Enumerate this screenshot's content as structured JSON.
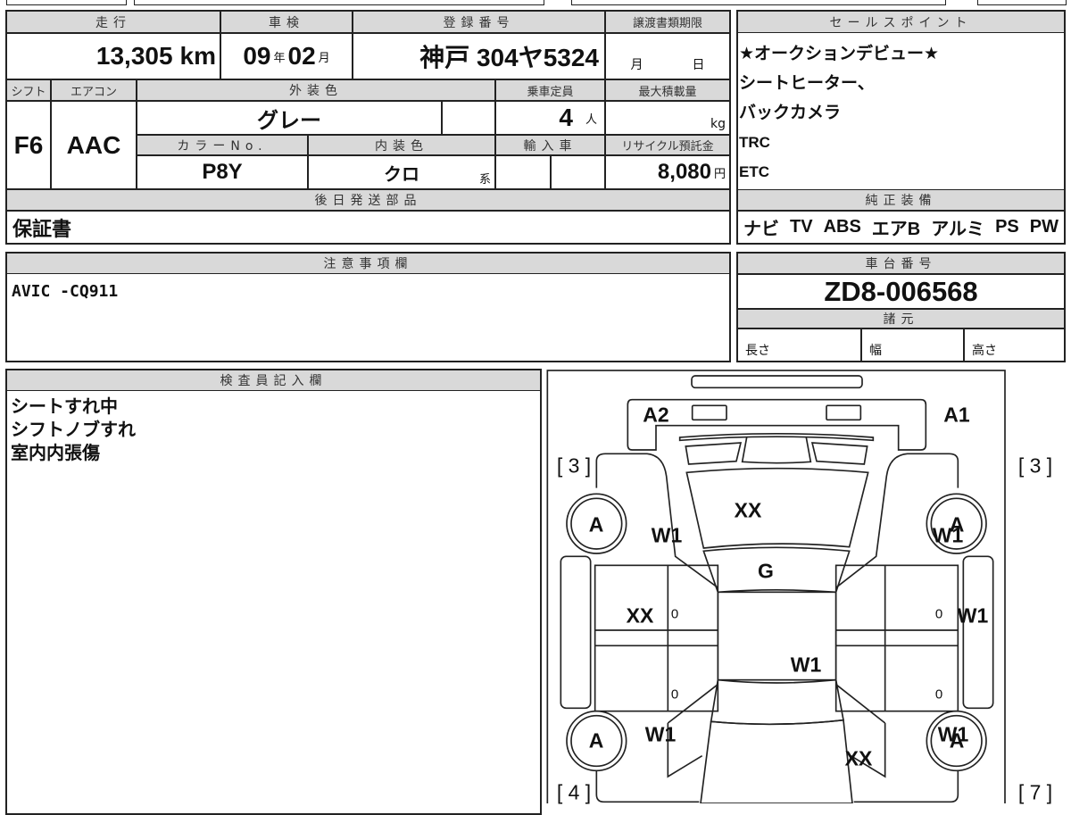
{
  "main_table": {
    "mileage": {
      "header": "走行",
      "value": "13,305",
      "unit": "km"
    },
    "inspection": {
      "header": "車検",
      "year": "09",
      "year_unit": "年",
      "month": "02",
      "month_unit": "月"
    },
    "registration": {
      "header": "登録番号",
      "value": "神戸 304ヤ5324"
    },
    "transfer_deadline": {
      "header": "譲渡書類期限",
      "month_unit": "月",
      "day_unit": "日"
    },
    "shift": {
      "header": "シフト",
      "value": "F6"
    },
    "aircon": {
      "header": "エアコン",
      "value": "AAC"
    },
    "exterior_color": {
      "header": "外装色",
      "value": "グレー"
    },
    "capacity": {
      "header": "乗車定員",
      "value": "4",
      "unit": "人"
    },
    "max_load": {
      "header": "最大積載量",
      "unit": "kg"
    },
    "color_no": {
      "header": "カラーNo.",
      "value": "P8Y"
    },
    "interior_color": {
      "header": "内装色",
      "value": "クロ",
      "unit": "系"
    },
    "import": {
      "header": "輸入車"
    },
    "recycle_fee": {
      "header": "リサイクル預託金",
      "value": "8,080",
      "unit": "円"
    },
    "later_parts": {
      "header": "後日発送部品",
      "value": "保証書"
    }
  },
  "sales_points": {
    "header": "セールスポイント",
    "lines": [
      "★オークションデビュー★",
      "シートヒーター、",
      "バックカメラ",
      "TRC",
      "ETC"
    ]
  },
  "equipment": {
    "header": "純正装備",
    "items": [
      "ナビ",
      "TV",
      "ABS",
      "エアB",
      "アルミ",
      "PS",
      "PW"
    ]
  },
  "notes": {
    "header": "注意事項欄",
    "value": "AVIC -CQ911"
  },
  "chassis": {
    "header": "車台番号",
    "value": "ZD8-006568"
  },
  "specs": {
    "header": "諸元",
    "length": "長さ",
    "width": "幅",
    "height": "高さ"
  },
  "inspector": {
    "header": "検査員記入欄",
    "lines": [
      "シートすれ中",
      "シフトノブすれ",
      "室内内張傷"
    ]
  },
  "diagram": {
    "labels": {
      "a2": "A2",
      "a1": "A1",
      "fl_bracket": "[ 3 ]",
      "fr_bracket": "[ 3 ]",
      "rl_bracket": "[ 4 ]",
      "rr_bracket": "[ 7 ]",
      "wheel_fl": "A",
      "wheel_fr": "A",
      "wheel_rl": "A",
      "wheel_rr": "A",
      "fender_fl": "W1",
      "hood": "XX",
      "fender_fr": "W1",
      "windshield": "G",
      "door_fl": "XX",
      "door_fr": "W1",
      "roof": "W1",
      "fender_rl": "W1",
      "fender_rr": "W1",
      "trunk": "XX",
      "z1": "0",
      "z2": "0",
      "z3": "0",
      "z4": "0"
    }
  }
}
